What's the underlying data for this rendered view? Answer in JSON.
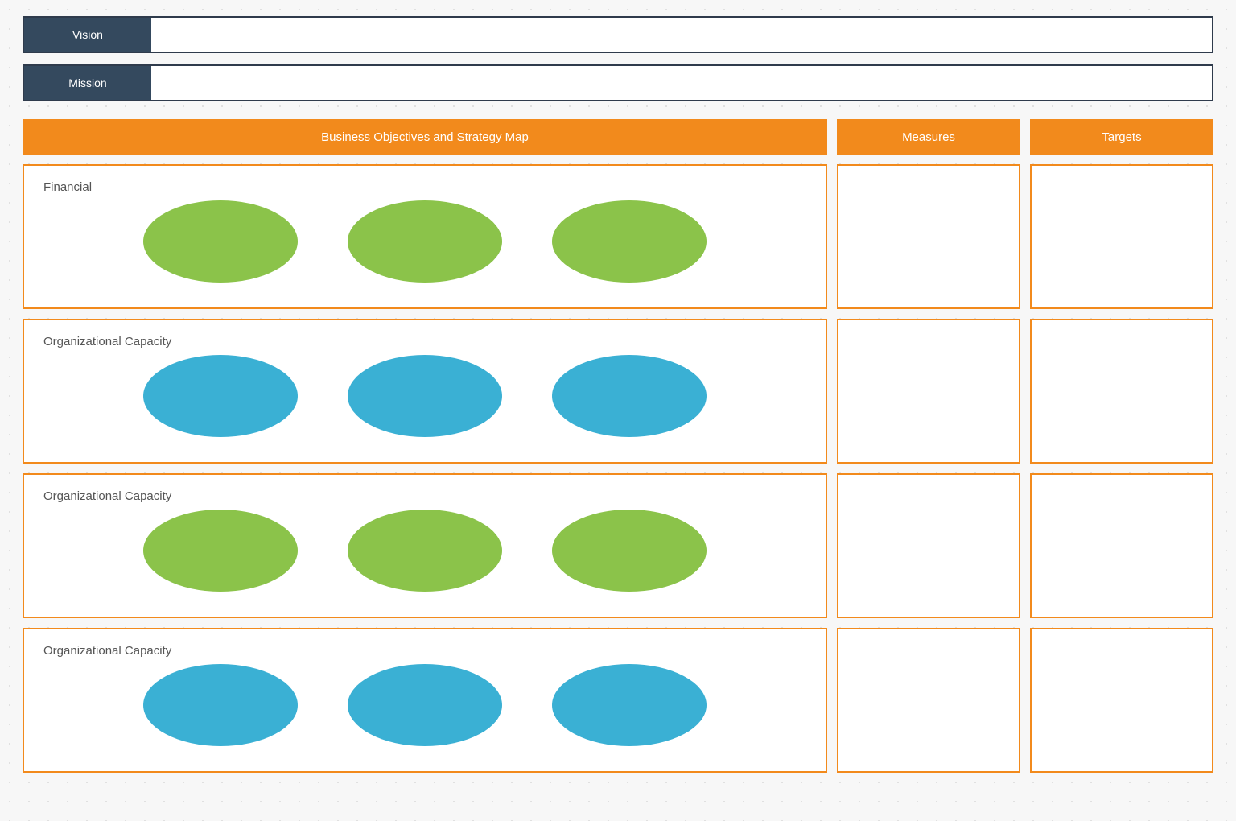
{
  "vision_label": "Vision",
  "mission_label": "Mission",
  "headers": {
    "main": "Business Objectives and Strategy Map",
    "measures": "Measures",
    "targets": "Targets"
  },
  "perspectives": [
    {
      "label": "Financial",
      "ellipse_color": "green"
    },
    {
      "label": "Organizational Capacity",
      "ellipse_color": "blue"
    },
    {
      "label": "Organizational Capacity",
      "ellipse_color": "green"
    },
    {
      "label": "Organizational Capacity",
      "ellipse_color": "blue"
    }
  ],
  "colors": {
    "accent": "#f28a1c",
    "navy": "#34495e",
    "green": "#8bc34a",
    "blue": "#3ab0d4"
  }
}
